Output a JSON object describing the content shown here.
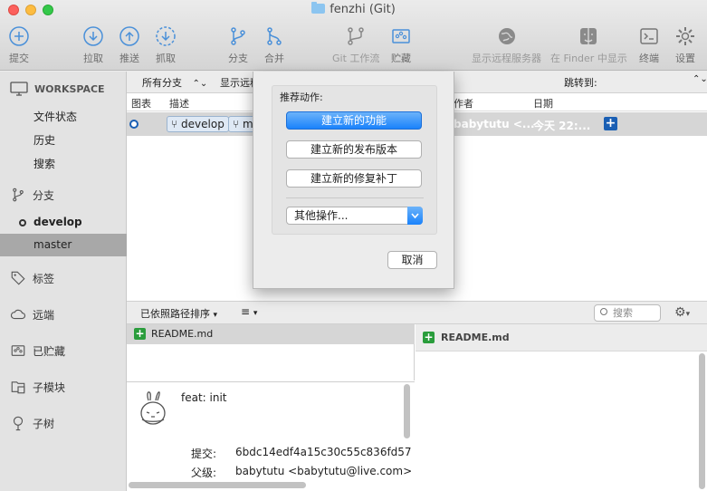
{
  "window": {
    "title": "fenzhi (Git)"
  },
  "toolbar": {
    "commit": "提交",
    "pull": "拉取",
    "push": "推送",
    "fetch": "抓取",
    "branch": "分支",
    "merge": "合并",
    "gitflow": "Git 工作流",
    "stash": "贮藏",
    "remote": "显示远程服务器",
    "finder": "在 Finder 中显示",
    "terminal": "终端",
    "settings": "设置"
  },
  "sidebar": {
    "workspace": "WORKSPACE",
    "file_status": "文件状态",
    "history": "历史",
    "search": "搜索",
    "branches": "分支",
    "develop": "develop",
    "master": "master",
    "tags": "标签",
    "remotes": "远端",
    "stashes": "已贮藏",
    "submodules": "子模块",
    "subtrees": "子树"
  },
  "filter": {
    "all_branches": "所有分支",
    "show_remote": "显示远程",
    "jump_to": "跳转到:"
  },
  "columns": {
    "graph": "图表",
    "desc": "描述",
    "author": "作者",
    "date": "日期"
  },
  "commit_row": {
    "branch1": "develop",
    "branch2": "m",
    "author": "babytutu <...",
    "date": "今天 22:..."
  },
  "lower": {
    "sort": "已依照路径排序",
    "search_placeholder": "搜索"
  },
  "files": {
    "readme": "README.md"
  },
  "diff": {
    "filename": "README.md"
  },
  "commit_detail": {
    "message": "feat: init",
    "commit_label": "提交:",
    "commit_hash": "6bdc14edf4a15c30c55c836fd57",
    "parent_label": "父级:",
    "parent_value": "babytutu <babytutu@live.com>"
  },
  "sheet": {
    "title": "推荐动作:",
    "new_feature": "建立新的功能",
    "new_release": "建立新的发布版本",
    "new_hotfix": "建立新的修复补丁",
    "other": "其他操作...",
    "cancel": "取消"
  }
}
